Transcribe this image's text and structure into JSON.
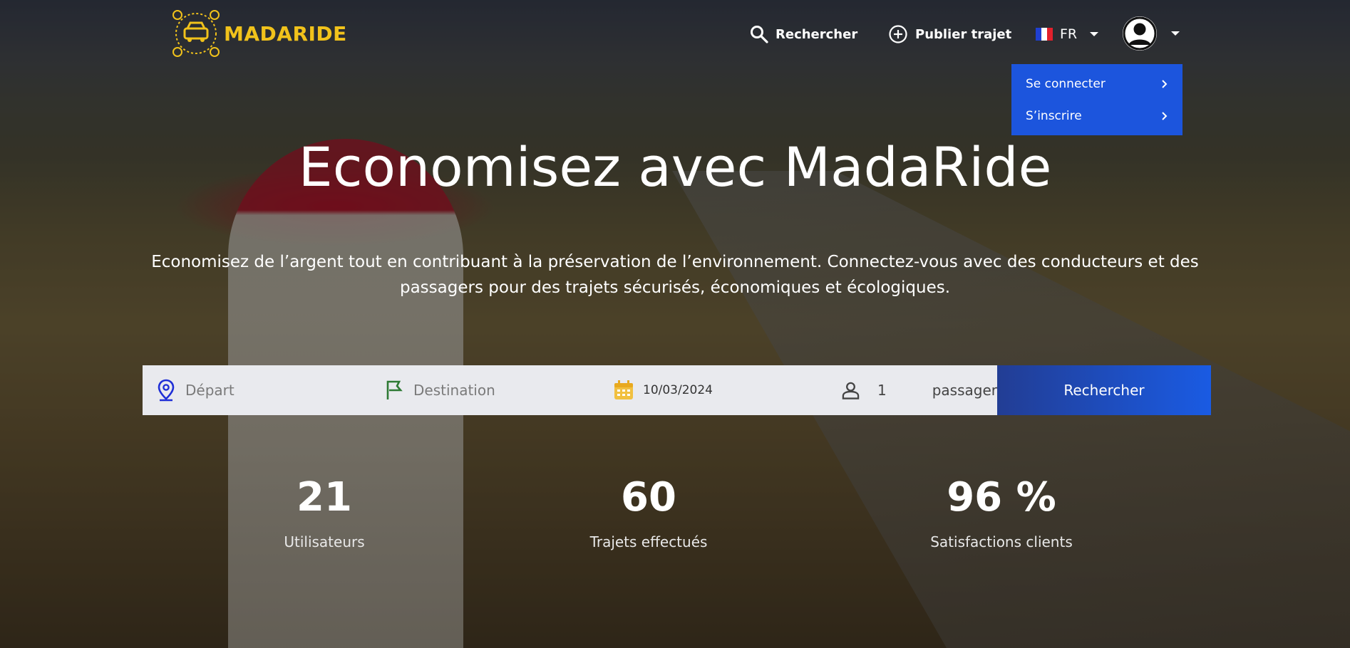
{
  "brand": {
    "name": "MADARIDE",
    "color": "#f1c21b"
  },
  "nav": {
    "search_label": "Rechercher",
    "publish_label": "Publier trajet",
    "language": "FR"
  },
  "user_menu": {
    "items": [
      {
        "label": "Se connecter"
      },
      {
        "label": "S’inscrire"
      }
    ],
    "color": "#1c55dd"
  },
  "hero": {
    "title": "Economisez avec MadaRide",
    "subtitle": "Economisez de l’argent tout en contribuant à la préservation de l’environnement. Connectez-vous avec des conducteurs et des passagers pour des trajets sécurisés, économiques et écologiques."
  },
  "search": {
    "departure_placeholder": "Départ",
    "destination_placeholder": "Destination",
    "date": "10/03/2024",
    "passenger_count": "1",
    "passenger_label": "passager",
    "button_label": "Rechercher",
    "icons": [
      "location-pin-icon",
      "flag-icon",
      "calendar-icon",
      "person-icon"
    ]
  },
  "stats": [
    {
      "value": "21",
      "label": "Utilisateurs"
    },
    {
      "value": "60",
      "label": "Trajets effectués"
    },
    {
      "value": "96 %",
      "label": "Satisfactions clients"
    }
  ]
}
